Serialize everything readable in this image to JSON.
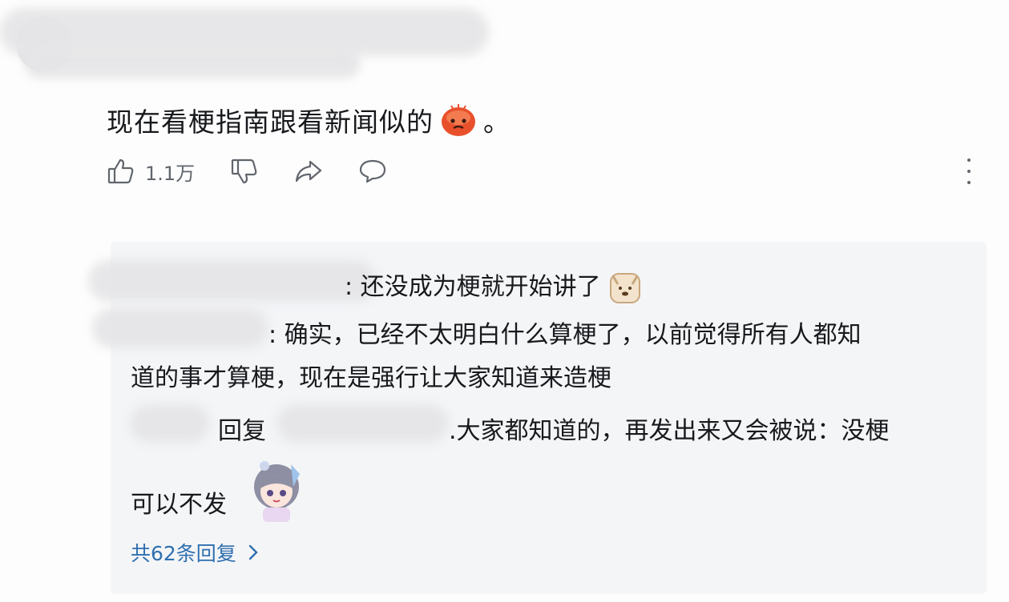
{
  "comment": {
    "text": "现在看梗指南跟看新闻似的",
    "text_end": "。",
    "like_count": "1.1万"
  },
  "replies": [
    {
      "body": ": 还没成为梗就开始讲了"
    },
    {
      "body_line1": ": 确实，已经不太明白什么算梗了，以前觉得所有人都知",
      "body_line2": "道的事才算梗，现在是强行让大家知道来造梗"
    },
    {
      "reply_label": "回复",
      "body_line1": ".大家都知道的，再发出来又会被说：没梗",
      "body_line2": "可以不发"
    }
  ],
  "total_replies": "共62条回复",
  "icons": [
    "thumbs-up-icon",
    "thumbs-down-icon",
    "share-icon",
    "comment-icon",
    "more-icon",
    "chevron-right-icon"
  ]
}
